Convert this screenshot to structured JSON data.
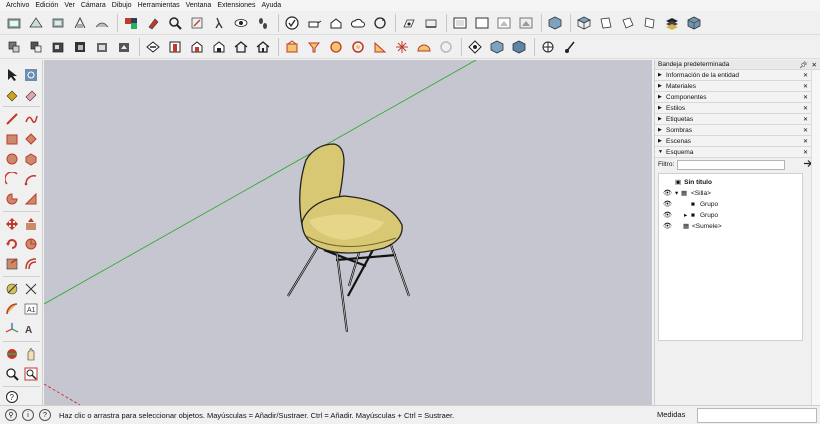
{
  "menu": [
    "Archivo",
    "Edición",
    "Ver",
    "Cámara",
    "Dibujo",
    "Herramientas",
    "Ventana",
    "Extensiones",
    "Ayuda"
  ],
  "toolbar1_icons": [
    "tape-measure-icon",
    "dimension-icon",
    "protractor-icon",
    "text-icon",
    "axes-icon",
    "3d-text-icon",
    "paint-bucket-icon",
    "search-icon",
    "walk-icon",
    "look-around-icon",
    "position-camera-icon",
    "eye-icon",
    "footprint-icon",
    "warehouse-icon",
    "model-info-icon",
    "teapot-icon",
    "cloud-icon",
    "refresh-icon",
    "section-plane-icon",
    "section-display-icon",
    "section-cut-icon",
    "xray-icon",
    "back-edges-icon",
    "wireframe-icon",
    "hidden-line-icon",
    "shaded-icon",
    "shaded-textures-icon",
    "monochrome-icon",
    "iso-view-icon",
    "top-view-icon",
    "front-view-icon",
    "right-view-icon",
    "back-view-icon",
    "left-view-icon"
  ],
  "toolbar2_icons": [
    "component-icon",
    "group-icon",
    "make-group-icon",
    "explode-icon",
    "lock-icon",
    "sandbox-contours-icon",
    "sandbox-scratch-icon",
    "smoove-icon",
    "stamp-icon",
    "drape-icon",
    "add-detail-icon",
    "flip-edge-icon",
    "house-icon",
    "save-icon",
    "solid-outer-shell-icon",
    "intersect-icon",
    "union-icon",
    "subtract-icon",
    "trim-icon",
    "split-icon",
    "orbit-icon",
    "pan-icon",
    "zoom-icon",
    "zoom-extents-icon",
    "add-location-icon",
    "toggle-terrain-icon"
  ],
  "tray": {
    "title": "Bandeja predeterminada",
    "panels": [
      {
        "label": "Información de la entidad",
        "open": false
      },
      {
        "label": "Materiales",
        "open": false
      },
      {
        "label": "Componentes",
        "open": false
      },
      {
        "label": "Estilos",
        "open": false
      },
      {
        "label": "Etiquetas",
        "open": false
      },
      {
        "label": "Sombras",
        "open": false
      },
      {
        "label": "Escenas",
        "open": false
      },
      {
        "label": "Esquema",
        "open": true
      }
    ],
    "filter_label": "Filtro:",
    "filter_value": "",
    "outliner": {
      "root": "Sin título",
      "items": [
        {
          "label": "<Silla>",
          "expanded": true
        },
        {
          "label": "Grupo",
          "expanded": false
        },
        {
          "label": "Grupo",
          "expanded": false
        },
        {
          "label": "<Sumele>",
          "expanded": false
        }
      ]
    }
  },
  "status": {
    "hint": "Haz clic o arrastra para seleccionar objetos. Mayúsculas = Añadir/Sustraer. Ctrl = Añadir. Mayúsculas + Ctrl = Sustraer.",
    "measurements_label": "Medidas",
    "measurements_value": ""
  },
  "colors": {
    "viewport_bg": "#c5c6cf",
    "chair_seat": "#d9c873",
    "green_axis": "#22aa22",
    "red_axis": "#cc2222",
    "accent_red": "#c0392b"
  }
}
